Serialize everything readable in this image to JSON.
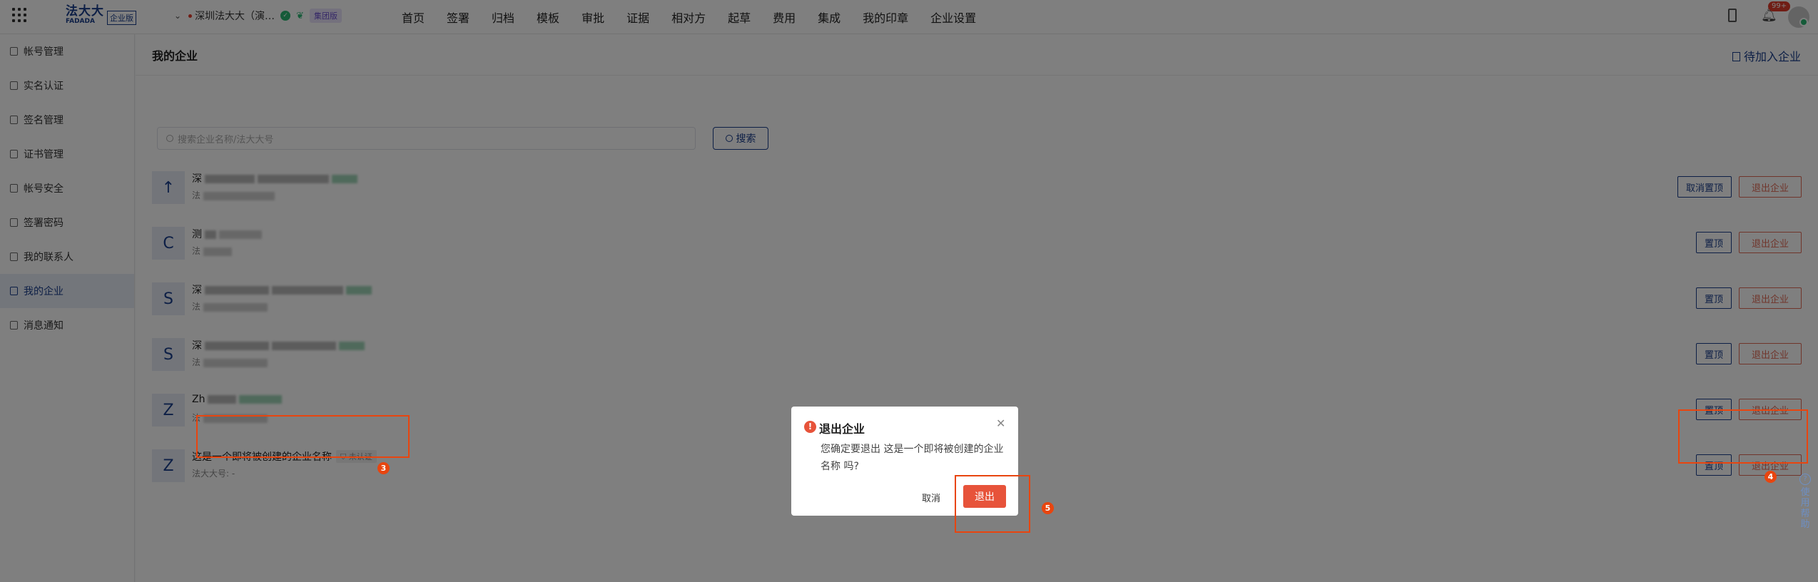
{
  "logo": {
    "cn": "法大大",
    "en": "FADADA",
    "tag": "企业版"
  },
  "org": {
    "name": "深圳法大大（演…",
    "group_tag": "集团版"
  },
  "nav": [
    "首页",
    "签署",
    "归档",
    "模板",
    "审批",
    "证据",
    "相对方",
    "起草",
    "费用",
    "集成",
    "我的印章",
    "企业设置"
  ],
  "notifications": {
    "count": "99+"
  },
  "sidebar": {
    "items": [
      {
        "label": "帐号管理"
      },
      {
        "label": "实名认证"
      },
      {
        "label": "签名管理"
      },
      {
        "label": "证书管理"
      },
      {
        "label": "帐号安全"
      },
      {
        "label": "签署密码"
      },
      {
        "label": "我的联系人"
      },
      {
        "label": "我的企业"
      },
      {
        "label": "消息通知"
      }
    ]
  },
  "page": {
    "title": "我的企业",
    "pending_link": "待加入企业"
  },
  "search": {
    "placeholder": "搜索企业名称/法大大号",
    "button": "搜索"
  },
  "companies": [
    {
      "avatar": "↑",
      "name_prefix": "深",
      "sub_prefix": "法",
      "primary_action": "取消置顶",
      "secondary_action": "退出企业"
    },
    {
      "avatar": "C",
      "name_prefix": "测",
      "sub_prefix": "法",
      "primary_action": "置顶",
      "secondary_action": "退出企业"
    },
    {
      "avatar": "S",
      "name_prefix": "深",
      "sub_prefix": "法",
      "primary_action": "置顶",
      "secondary_action": "退出企业"
    },
    {
      "avatar": "S",
      "name_prefix": "深",
      "sub_prefix": "法",
      "primary_action": "置顶",
      "secondary_action": "退出企业"
    },
    {
      "avatar": "Z",
      "name_prefix": "Zh",
      "sub_prefix": "法",
      "primary_action": "置顶",
      "secondary_action": "退出企业"
    },
    {
      "avatar": "Z",
      "name": "这是一个即将被创建的企业名称",
      "cert_tag": "未认证",
      "sub": "法大大号: -",
      "primary_action": "置顶",
      "secondary_action": "退出企业"
    }
  ],
  "modal": {
    "title": "退出企业",
    "body": "您确定要退出 这是一个即将被创建的企业名称 吗?",
    "cancel": "取消",
    "confirm": "退出"
  },
  "markers": [
    "3",
    "4",
    "5"
  ],
  "help": {
    "label": "使用帮助"
  },
  "colors": {
    "brand": "#1a3e8c",
    "danger": "#e7533a",
    "highlight": "#e8450f",
    "success": "#2bb673"
  }
}
